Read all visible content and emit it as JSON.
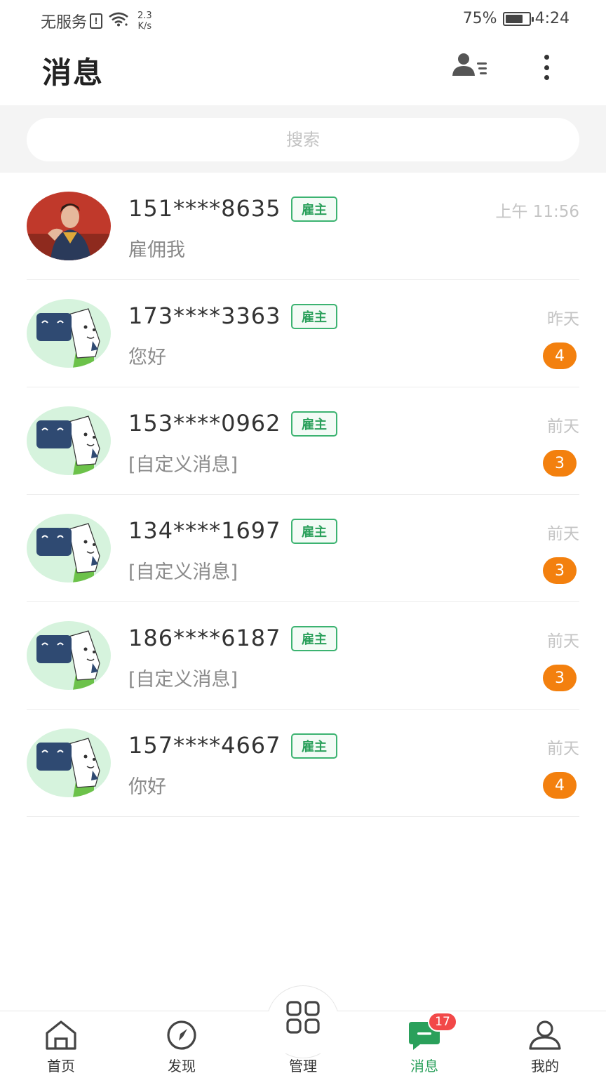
{
  "status_bar": {
    "carrier": "无服务",
    "sim_label": "!",
    "speed_value": "2.3",
    "speed_unit": "K/s",
    "battery": "75%",
    "battery_level": 0.75,
    "time": "4:24"
  },
  "header": {
    "title": "消息",
    "contacts_icon": "contacts-list-icon",
    "more_icon": "more-vertical-icon"
  },
  "search": {
    "placeholder": "搜索"
  },
  "conversations": [
    {
      "name": "151****8635",
      "tag": "雇主",
      "preview": "雇佣我",
      "time": "上午 11:56",
      "badge": "",
      "avatar": "photo-avatar"
    },
    {
      "name": "173****3363",
      "tag": "雇主",
      "preview": "您好",
      "time": "昨天",
      "badge": "4",
      "avatar": "cartoon-avatar"
    },
    {
      "name": "153****0962",
      "tag": "雇主",
      "preview": "[自定义消息]",
      "time": "前天",
      "badge": "3",
      "avatar": "cartoon-avatar"
    },
    {
      "name": "134****1697",
      "tag": "雇主",
      "preview": "[自定义消息]",
      "time": "前天",
      "badge": "3",
      "avatar": "cartoon-avatar"
    },
    {
      "name": "186****6187",
      "tag": "雇主",
      "preview": "[自定义消息]",
      "time": "前天",
      "badge": "3",
      "avatar": "cartoon-avatar"
    },
    {
      "name": "157****4667",
      "tag": "雇主",
      "preview": "你好",
      "time": "前天",
      "badge": "4",
      "avatar": "cartoon-avatar"
    }
  ],
  "tabbar": {
    "tabs": [
      {
        "label": "首页",
        "icon": "home-icon"
      },
      {
        "label": "发现",
        "icon": "compass-icon"
      },
      {
        "label": "管理",
        "icon": "grid-icon"
      },
      {
        "label": "消息",
        "icon": "message-icon",
        "active": true
      },
      {
        "label": "我的",
        "icon": "profile-icon"
      }
    ],
    "message_badge": "17"
  },
  "colors": {
    "accent_green": "#2aa05b",
    "badge_orange": "#f3800e",
    "badge_red": "#f24848"
  }
}
